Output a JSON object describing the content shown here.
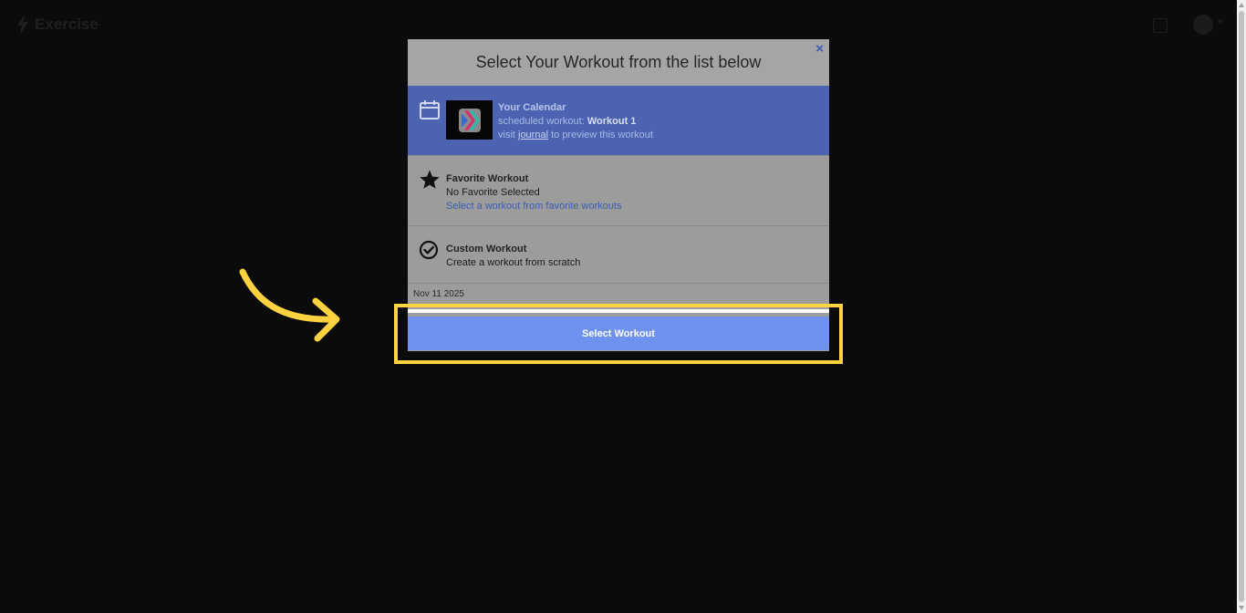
{
  "app": {
    "brand": "Exercise",
    "nav": [
      "",
      "",
      "",
      ""
    ]
  },
  "modal": {
    "title": "Select Your Workout from the list below",
    "close_icon": "×",
    "calendar_option": {
      "title": "Your Calendar",
      "line1_prefix": "scheduled workout: ",
      "workout_name": "Workout 1",
      "line2_prefix": "visit ",
      "journal_link": "journal",
      "line2_suffix": " to preview this workout",
      "icon": "calendar-icon"
    },
    "favorite_option": {
      "title": "Favorite Workout",
      "subtitle": "No Favorite Selected",
      "link": "Select a workout from favorite workouts",
      "icon": "star-icon"
    },
    "custom_option": {
      "title": "Custom Workout",
      "subtitle": "Create a workout from scratch",
      "icon": "check-circle-icon"
    },
    "date": "Nov 11 2025",
    "select_button": "Select Workout"
  },
  "colors": {
    "highlight": "#ffd23f",
    "button": "#6f91ef",
    "calendar_row": "#4b63b1",
    "overlay_bg": "#0b0b0b"
  }
}
